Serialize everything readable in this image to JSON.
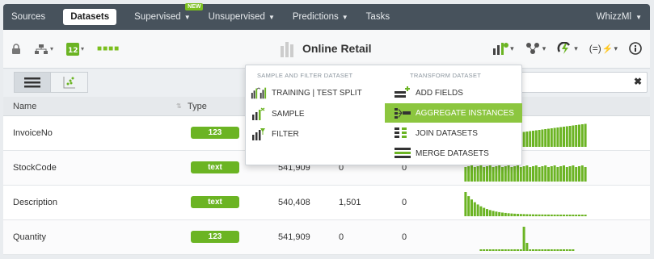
{
  "nav": {
    "items": [
      "Sources",
      "Datasets",
      "Supervised",
      "Unsupervised",
      "Predictions",
      "Tasks"
    ],
    "new_badge": "NEW",
    "user": "WhizzMl"
  },
  "toolbar": {
    "title": "Online Retail"
  },
  "dropdown": {
    "left_header": "SAMPLE AND FILTER DATASET",
    "right_header": "TRANSFORM DATASET",
    "left_items": [
      "TRAINING | TEST SPLIT",
      "SAMPLE",
      "FILTER"
    ],
    "right_items": [
      "ADD FIELDS",
      "AGGREGATE INSTANCES",
      "JOIN DATASETS",
      "MERGE DATASETS"
    ],
    "highlighted": "AGGREGATE INSTANCES"
  },
  "table": {
    "headers": {
      "name": "Name",
      "type": "Type"
    },
    "rows": [
      {
        "name": "InvoiceNo",
        "type": "123",
        "count": "",
        "missing": "",
        "errors": ""
      },
      {
        "name": "StockCode",
        "type": "text",
        "count": "541,909",
        "missing": "0",
        "errors": "0"
      },
      {
        "name": "Description",
        "type": "text",
        "count": "540,408",
        "missing": "1,501",
        "errors": "0"
      },
      {
        "name": "Quantity",
        "type": "123",
        "count": "541,909",
        "missing": "0",
        "errors": "0"
      }
    ]
  },
  "colors": {
    "accent": "#7bbf1e",
    "nav_bg": "#47525c",
    "highlight": "#8cc63f"
  }
}
